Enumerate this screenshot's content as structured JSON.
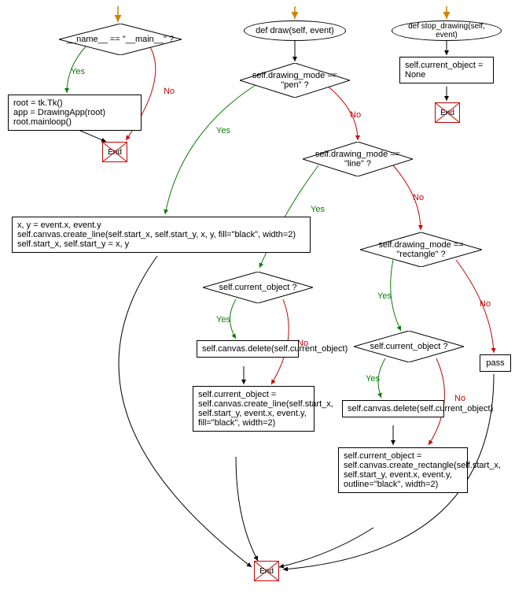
{
  "flow": {
    "main_cond": "__name__ == \"__main__\" ?",
    "main_body": "root = tk.Tk()\napp = DrawingApp(root)\nroot.mainloop()",
    "draw_def": "def draw(self, event)",
    "stop_def": "def stop_drawing(self, event)",
    "stop_body": "self.current_object = None",
    "pen_cond": "self.drawing_mode == \"pen\" ?",
    "line_cond": "self.drawing_mode == \"line\" ?",
    "rect_cond": "self.drawing_mode == \"rectangle\" ?",
    "pen_body": "x, y = event.x, event.y\nself.canvas.create_line(self.start_x, self.start_y, x, y, fill=\"black\", width=2)\nself.start_x, self.start_y = x, y",
    "line_cur_cond": "self.current_object ?",
    "line_delete": "self.canvas.delete(self.current_object)",
    "line_create": "self.current_object = self.canvas.create_line(self.start_x, self.start_y, event.x, event.y, fill=\"black\", width=2)",
    "rect_cur_cond": "self.current_object ?",
    "rect_delete": "self.canvas.delete(self.current_object)",
    "rect_create": "self.current_object = self.canvas.create_rectangle(self.start_x, self.start_y, event.x, event.y, outline=\"black\", width=2)",
    "pass": "pass",
    "end": "End",
    "yes": "Yes",
    "no": "No"
  }
}
